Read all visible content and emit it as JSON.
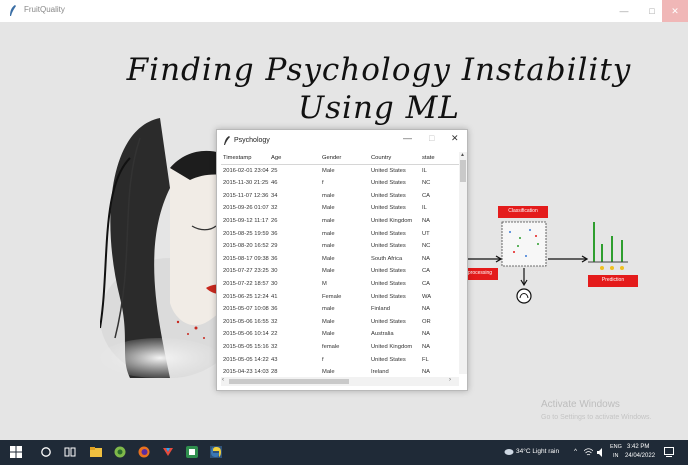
{
  "window": {
    "title": "FruitQuality"
  },
  "headline": {
    "line1": "Finding Psychology Instability",
    "line2": "Using ML"
  },
  "diagram": {
    "classification_label": "Classification",
    "processing_label": "processing",
    "prediction_label": "Prediction"
  },
  "watermark": {
    "line1": "Activate Windows",
    "line2": "Go to Settings to activate Windows."
  },
  "psychology_window": {
    "title": "Psychology",
    "columns": [
      "Timestamp",
      "Age",
      "Gender",
      "Country",
      "state"
    ],
    "rows": [
      [
        "2016-02-01 23:04:",
        "25",
        "Male",
        "United States",
        "IL"
      ],
      [
        "2015-11-30 21:25:",
        "46",
        "f",
        "United States",
        "NC"
      ],
      [
        "2015-11-07 12:36:",
        "34",
        "male",
        "United States",
        "CA"
      ],
      [
        "2015-09-26 01:07:",
        "32",
        "Male",
        "United States",
        "IL"
      ],
      [
        "2015-09-12 11:17:",
        "26",
        "male",
        "United Kingdom",
        "NA"
      ],
      [
        "2015-08-25 19:59:",
        "36",
        "male",
        "United States",
        "UT"
      ],
      [
        "2015-08-20 16:52:",
        "29",
        "male",
        "United States",
        "NC"
      ],
      [
        "2015-08-17 09:38:",
        "36",
        "Male",
        "South Africa",
        "NA"
      ],
      [
        "2015-07-27 23:25:",
        "30",
        "Male",
        "United States",
        "CA"
      ],
      [
        "2015-07-22 18:57:",
        "30",
        "M",
        "United States",
        "CA"
      ],
      [
        "2015-06-25 12:24:",
        "41",
        "Female",
        "United States",
        "WA"
      ],
      [
        "2015-05-07 10:08:",
        "36",
        "male",
        "Finland",
        "NA"
      ],
      [
        "2015-05-06 16:55:",
        "32",
        "Male",
        "United States",
        "OR"
      ],
      [
        "2015-05-06 10:14:",
        "22",
        "Male",
        "Australia",
        "NA"
      ],
      [
        "2015-05-05 15:16:",
        "32",
        "female",
        "United Kingdom",
        "NA"
      ],
      [
        "2015-05-05 14:22:",
        "43",
        "f",
        "United States",
        "FL"
      ],
      [
        "2015-04-23 14:03:",
        "28",
        "Male",
        "Ireland",
        "NA"
      ]
    ]
  },
  "taskbar": {
    "weather": "34°C Light rain",
    "lang": "ENG",
    "region": "IN",
    "time": "3:42 PM",
    "date": "24/04/2022"
  },
  "colors": {
    "accent_red": "#e41b1b",
    "taskbar": "#1f2a37",
    "chart_green": "#2e9e2e"
  }
}
